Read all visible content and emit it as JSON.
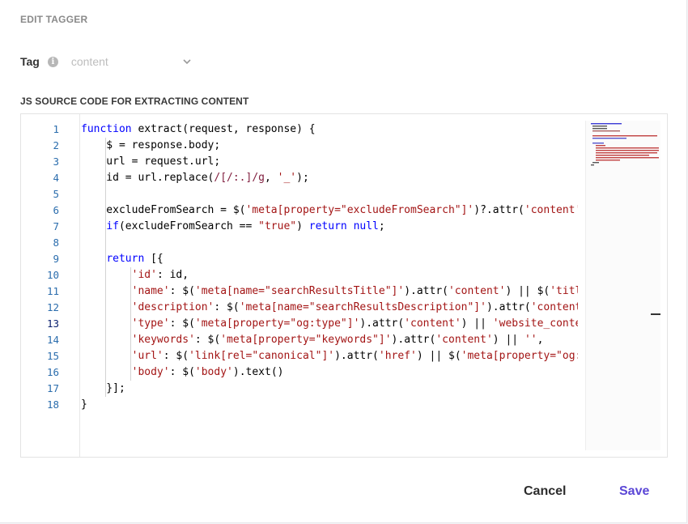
{
  "dialog": {
    "title": "EDIT TAGGER",
    "tag_label": "Tag",
    "tag_value": "content",
    "info_icon": "info-icon",
    "section_label": "JS SOURCE CODE FOR EXTRACTING CONTENT",
    "cancel_label": "Cancel",
    "save_label": "Save"
  },
  "colors": {
    "keyword": "#0000ff",
    "string": "#a31515",
    "regex": "#811f3f",
    "line_number": "#2b6dad",
    "save_accent": "#5b47d6"
  },
  "editor": {
    "line_numbers": [
      "1",
      "2",
      "3",
      "4",
      "5",
      "6",
      "7",
      "8",
      "9",
      "10",
      "11",
      "12",
      "13",
      "14",
      "15",
      "16",
      "17",
      "18"
    ],
    "active_line": "13",
    "lines": [
      [
        {
          "t": "function",
          "c": "k"
        },
        {
          "t": " extract(request, response) {"
        }
      ],
      [
        {
          "t": "    $ = response.body;"
        }
      ],
      [
        {
          "t": "    url = request.url;"
        }
      ],
      [
        {
          "t": "    id = url.replace("
        },
        {
          "t": "/[/:.]/g",
          "c": "r"
        },
        {
          "t": ", "
        },
        {
          "t": "'_'",
          "c": "s"
        },
        {
          "t": ");"
        }
      ],
      [
        {
          "t": ""
        }
      ],
      [
        {
          "t": "    excludeFromSearch = $("
        },
        {
          "t": "'meta[property=\"excludeFromSearch\"]'",
          "c": "s"
        },
        {
          "t": ")?.attr("
        },
        {
          "t": "'content'",
          "c": "s"
        },
        {
          "t": ")"
        }
      ],
      [
        {
          "t": "    "
        },
        {
          "t": "if",
          "c": "k"
        },
        {
          "t": "(excludeFromSearch == "
        },
        {
          "t": "\"true\"",
          "c": "s"
        },
        {
          "t": ") "
        },
        {
          "t": "return",
          "c": "k"
        },
        {
          "t": " "
        },
        {
          "t": "null",
          "c": "k"
        },
        {
          "t": ";"
        }
      ],
      [
        {
          "t": ""
        }
      ],
      [
        {
          "t": "    "
        },
        {
          "t": "return",
          "c": "k"
        },
        {
          "t": " [{"
        }
      ],
      [
        {
          "t": "        "
        },
        {
          "t": "'id'",
          "c": "s"
        },
        {
          "t": ": id,"
        }
      ],
      [
        {
          "t": "        "
        },
        {
          "t": "'name'",
          "c": "s"
        },
        {
          "t": ": $("
        },
        {
          "t": "'meta[name=\"searchResultsTitle\"]'",
          "c": "s"
        },
        {
          "t": ").attr("
        },
        {
          "t": "'content'",
          "c": "s"
        },
        {
          "t": ") || $("
        },
        {
          "t": "'title",
          "c": "s"
        }
      ],
      [
        {
          "t": "        "
        },
        {
          "t": "'description'",
          "c": "s"
        },
        {
          "t": ": $("
        },
        {
          "t": "'meta[name=\"searchResultsDescription\"]'",
          "c": "s"
        },
        {
          "t": ").attr("
        },
        {
          "t": "'content'",
          "c": "s"
        }
      ],
      [
        {
          "t": "        "
        },
        {
          "t": "'type'",
          "c": "s"
        },
        {
          "t": ": $("
        },
        {
          "t": "'meta[property=\"og:type\"]'",
          "c": "s"
        },
        {
          "t": ").attr("
        },
        {
          "t": "'content'",
          "c": "s"
        },
        {
          "t": ") || "
        },
        {
          "t": "'website_conten",
          "c": "s"
        }
      ],
      [
        {
          "t": "        "
        },
        {
          "t": "'keywords'",
          "c": "s"
        },
        {
          "t": ": $("
        },
        {
          "t": "'meta[property=\"keywords\"]'",
          "c": "s"
        },
        {
          "t": ").attr("
        },
        {
          "t": "'content'",
          "c": "s"
        },
        {
          "t": ") || "
        },
        {
          "t": "''",
          "c": "s"
        },
        {
          "t": ","
        }
      ],
      [
        {
          "t": "        "
        },
        {
          "t": "'url'",
          "c": "s"
        },
        {
          "t": ": $("
        },
        {
          "t": "'link[rel=\"canonical\"]'",
          "c": "s"
        },
        {
          "t": ").attr("
        },
        {
          "t": "'href'",
          "c": "s"
        },
        {
          "t": ") || $("
        },
        {
          "t": "'meta[property=\"og:u",
          "c": "s"
        }
      ],
      [
        {
          "t": "        "
        },
        {
          "t": "'body'",
          "c": "s"
        },
        {
          "t": ": $("
        },
        {
          "t": "'body'",
          "c": "s"
        },
        {
          "t": ").text()"
        }
      ],
      [
        {
          "t": "    }];"
        }
      ],
      [
        {
          "t": "}"
        }
      ]
    ]
  }
}
